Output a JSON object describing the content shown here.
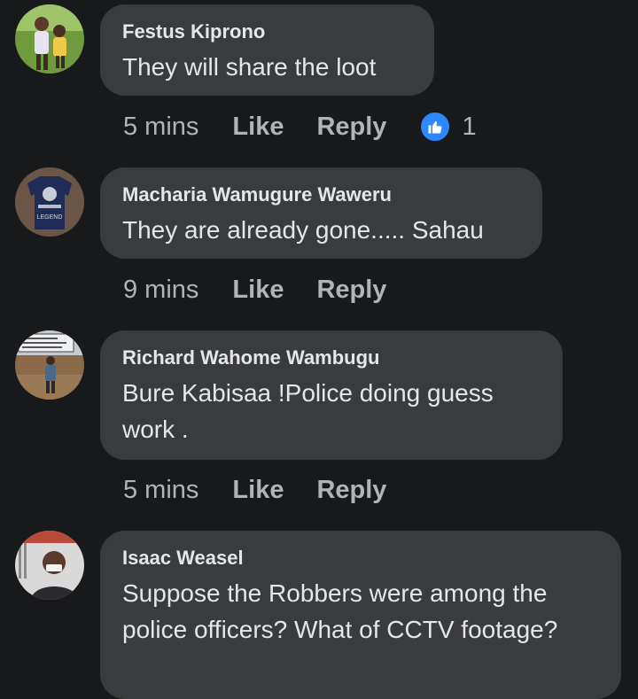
{
  "comments": [
    {
      "author": "Festus Kiprono",
      "text": "They will share the loot",
      "time": "5 mins",
      "like_label": "Like",
      "reply_label": "Reply",
      "reaction_count": "1",
      "avatar_icon": "profile-photo-children"
    },
    {
      "author": "Macharia Wamugure Waweru",
      "text": "They are already gone..... Sahau",
      "time": "9 mins",
      "like_label": "Like",
      "reply_label": "Reply",
      "avatar_icon": "profile-photo-tshirt",
      "avatar_text": "LEGEND"
    },
    {
      "author": "Richard Wahome Wambugu",
      "text": "Bure Kabisaa !Police doing guess work .",
      "time": "5 mins",
      "like_label": "Like",
      "reply_label": "Reply",
      "avatar_icon": "profile-photo-roadsign"
    },
    {
      "author": "Isaac Weasel",
      "text": "Suppose the Robbers were among the police officers? What of CCTV footage?",
      "avatar_icon": "profile-photo-masked-man"
    }
  ],
  "colors": {
    "background": "#18191a",
    "bubble": "#3a3b3c",
    "text": "#e4e6eb",
    "muted": "#b0b3b8",
    "like_blue": "#2d88ff"
  }
}
